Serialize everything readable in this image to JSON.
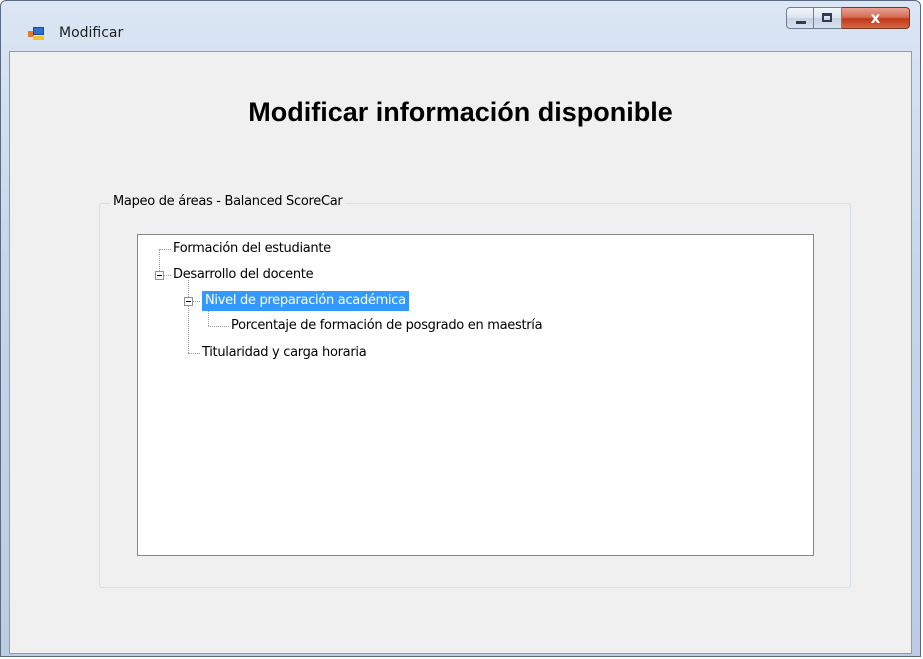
{
  "window": {
    "title": "Modificar",
    "minimize_icon": "minimize-icon",
    "maximize_icon": "maximize-icon",
    "close_icon": "close-icon",
    "close_glyph": "x"
  },
  "form": {
    "heading": "Modificar información disponible",
    "group_title": "Mapeo de áreas - Balanced ScoreCar"
  },
  "tree": {
    "nodes": [
      {
        "label": "Formación del estudiante",
        "level": 0,
        "expanded": false
      },
      {
        "label": "Desarrollo del docente",
        "level": 0,
        "expanded": true
      },
      {
        "label": "Nivel de preparación académica",
        "level": 1,
        "expanded": true,
        "selected": true
      },
      {
        "label": "Porcentaje de formación de posgrado en maestría",
        "level": 2,
        "expanded": false
      },
      {
        "label": "Titularidad y carga horaria",
        "level": 1,
        "expanded": false
      }
    ]
  },
  "colors": {
    "selection": "#3399ff",
    "form_background": "#f0f0f0"
  }
}
